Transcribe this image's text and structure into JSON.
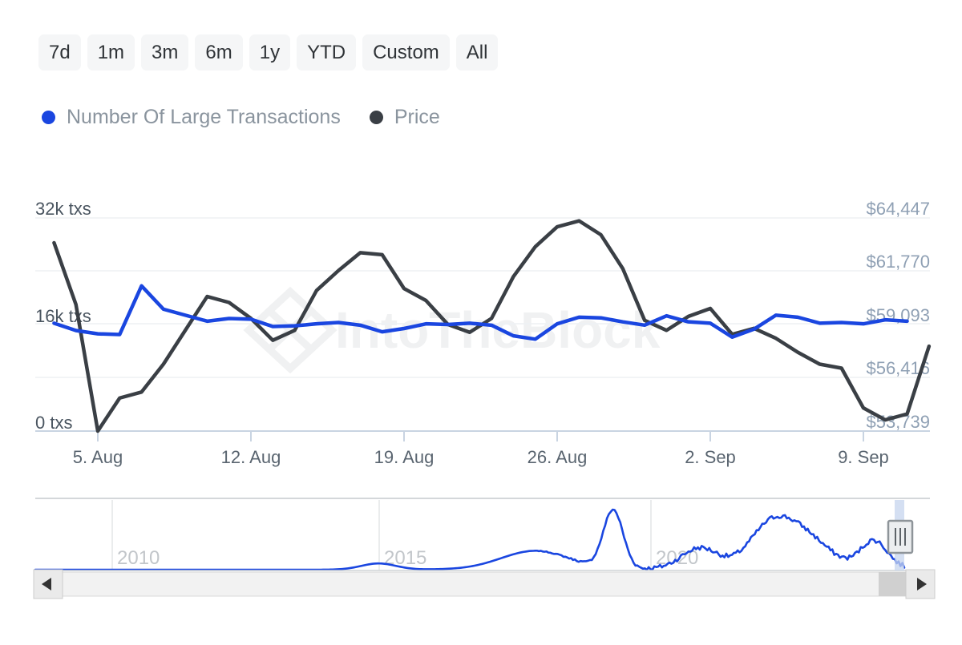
{
  "range_selector": {
    "buttons": [
      {
        "label": "7d",
        "selected": false
      },
      {
        "label": "1m",
        "selected": false
      },
      {
        "label": "3m",
        "selected": false
      },
      {
        "label": "6m",
        "selected": false
      },
      {
        "label": "1y",
        "selected": false
      },
      {
        "label": "YTD",
        "selected": false
      },
      {
        "label": "Custom",
        "selected": false
      },
      {
        "label": "All",
        "selected": false
      }
    ]
  },
  "legend": {
    "items": [
      {
        "label": "Number Of Large Transactions",
        "color": "#1a46e0"
      },
      {
        "label": "Price",
        "color": "#3a3f45"
      }
    ]
  },
  "watermark": {
    "text": "IntoTheBlock"
  },
  "navigator": {
    "year_labels": [
      "2010",
      "2015",
      "2020"
    ],
    "left_arrow": "◄",
    "right_arrow": "►",
    "handle_grip": "|||"
  },
  "chart_data": {
    "type": "line",
    "title": "",
    "xlabel": "",
    "grid": true,
    "legend_position": "top-left",
    "x_tick_labels": [
      "5. Aug",
      "12. Aug",
      "19. Aug",
      "26. Aug",
      "2. Sep",
      "9. Sep"
    ],
    "axes": {
      "left": {
        "label": "Number Of Large Transactions",
        "tick_labels": [
          "32k txs",
          "16k txs",
          "0 txs"
        ],
        "tick_values": [
          32000,
          16000,
          0
        ],
        "ylim": [
          0,
          32000
        ]
      },
      "right": {
        "label": "Price",
        "tick_labels": [
          "$64,447",
          "$61,770",
          "$59,093",
          "$56,416",
          "$53,739"
        ],
        "tick_values": [
          64447,
          61770,
          59093,
          56416,
          53739
        ],
        "ylim": [
          53739,
          64447
        ]
      }
    },
    "series": [
      {
        "name": "Number Of Large Transactions",
        "color": "#1a46e0",
        "axis": "left",
        "unit": "txs",
        "x": [
          "3. Aug",
          "4. Aug",
          "5. Aug",
          "6. Aug",
          "7. Aug",
          "8. Aug",
          "9. Aug",
          "10. Aug",
          "11. Aug",
          "12. Aug",
          "13. Aug",
          "14. Aug",
          "15. Aug",
          "16. Aug",
          "17. Aug",
          "18. Aug",
          "19. Aug",
          "20. Aug",
          "21. Aug",
          "22. Aug",
          "23. Aug",
          "24. Aug",
          "25. Aug",
          "26. Aug",
          "27. Aug",
          "28. Aug",
          "29. Aug",
          "30. Aug",
          "31. Aug",
          "1. Sep",
          "2. Sep",
          "3. Sep",
          "4. Sep",
          "5. Sep",
          "6. Sep",
          "7. Sep",
          "8. Sep",
          "9. Sep",
          "10. Sep",
          "11. Sep"
        ],
        "values": [
          16200,
          15100,
          14600,
          14500,
          21800,
          18300,
          17400,
          16500,
          16900,
          16800,
          15700,
          15800,
          16100,
          16300,
          15900,
          14900,
          15400,
          16100,
          16000,
          16200,
          15900,
          14300,
          13800,
          16100,
          17100,
          17000,
          16400,
          15900,
          17300,
          16400,
          16200,
          14100,
          15300,
          17400,
          17100,
          16200,
          16300,
          16100,
          16700,
          16500
        ]
      },
      {
        "name": "Price",
        "color": "#3a3f45",
        "axis": "right",
        "unit": "USD",
        "x": [
          "3. Aug",
          "4. Aug",
          "5. Aug",
          "6. Aug",
          "7. Aug",
          "8. Aug",
          "9. Aug",
          "10. Aug",
          "11. Aug",
          "12. Aug",
          "13. Aug",
          "14. Aug",
          "15. Aug",
          "16. Aug",
          "17. Aug",
          "18. Aug",
          "19. Aug",
          "20. Aug",
          "21. Aug",
          "22. Aug",
          "23. Aug",
          "24. Aug",
          "25. Aug",
          "26. Aug",
          "27. Aug",
          "28. Aug",
          "29. Aug",
          "30. Aug",
          "31. Aug",
          "1. Sep",
          "2. Sep",
          "3. Sep",
          "4. Sep",
          "5. Sep",
          "6. Sep",
          "7. Sep",
          "8. Sep",
          "9. Sep",
          "10. Sep",
          "11. Sep"
        ],
        "values": [
          63200,
          60100,
          53739,
          55400,
          55700,
          57100,
          58800,
          60500,
          60200,
          59400,
          58300,
          58800,
          60800,
          61800,
          62700,
          62600,
          60900,
          60300,
          59100,
          58700,
          59400,
          61500,
          63000,
          64000,
          64300,
          63600,
          61900,
          59300,
          58800,
          59500,
          59900,
          58600,
          58900,
          58400,
          57700,
          57100,
          56900,
          54900,
          54300,
          54600,
          58000
        ]
      }
    ],
    "navigator_series": {
      "name": "Number Of Large Transactions",
      "color": "#1a46e0",
      "x_range": [
        "2009",
        "2021"
      ],
      "year_ticks": [
        2010,
        2015,
        2020
      ],
      "selection": {
        "start_pct": 97.5,
        "end_pct": 100
      }
    }
  }
}
